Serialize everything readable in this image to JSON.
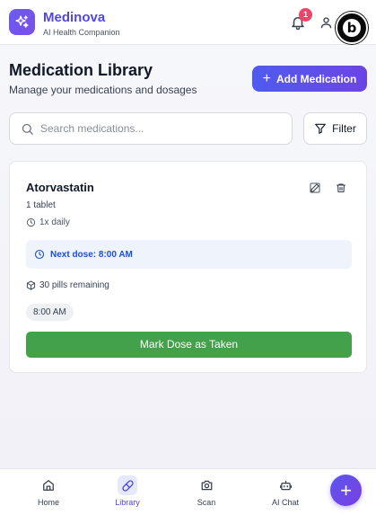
{
  "app": {
    "name": "Medinova",
    "tagline": "AI Health Companion",
    "notification_count": "1"
  },
  "page": {
    "title": "Medication Library",
    "subtitle": "Manage your medications and dosages",
    "add_button_label": "Add Medication"
  },
  "search": {
    "placeholder": "Search medications...",
    "value": "",
    "filter_label": "Filter"
  },
  "medications": [
    {
      "name": "Atorvastatin",
      "dosage": "1 tablet",
      "frequency": "1x daily",
      "next_dose": "Next dose: 8:00 AM",
      "pills_remaining": "30 pills remaining",
      "times": [
        "8:00 AM"
      ],
      "action_label": "Mark Dose as Taken"
    }
  ],
  "nav": {
    "items": [
      {
        "label": "Home",
        "icon": "home-icon",
        "active": false
      },
      {
        "label": "Library",
        "icon": "pill-icon",
        "active": true
      },
      {
        "label": "Scan",
        "icon": "camera-icon",
        "active": false
      },
      {
        "label": "AI Chat",
        "icon": "bot-icon",
        "active": false
      }
    ],
    "fab_icon": "plus-icon"
  },
  "colors": {
    "brand": "#4f46e5",
    "accent_gradient_start": "#4f5bf0",
    "accent_gradient_end": "#6d44e6",
    "success": "#43a04b",
    "next_dose_bg": "#eef3fc",
    "next_dose_text": "#1d4fd8",
    "notification": "#ef4468"
  }
}
